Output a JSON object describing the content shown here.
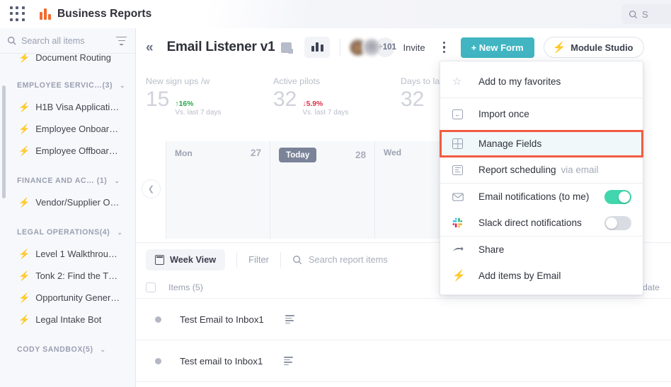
{
  "topbar": {
    "apps_icon": "apps-grid-icon",
    "logo_icon": "bar-chart-logo",
    "title": "Business Reports",
    "search_icon": "search-icon",
    "search_label": "S"
  },
  "sidebar": {
    "search": {
      "placeholder": "Search all items",
      "value": "",
      "icon": "search-icon",
      "filter_icon": "filter-icon"
    },
    "clipped_item": {
      "label": "Document Routing",
      "icon": "bolt-icon"
    },
    "groups": [
      {
        "label": "EMPLOYEE SERVIC…(3)",
        "chevron": "⌄",
        "items": [
          {
            "label": "H1B Visa Applicati…",
            "icon": "bolt-icon"
          },
          {
            "label": "Employee Onboar…",
            "icon": "bolt-icon"
          },
          {
            "label": "Employee Offboar…",
            "icon": "bolt-icon"
          }
        ]
      },
      {
        "label": "FINANCE AND AC… (1)",
        "chevron": "⌄",
        "items": [
          {
            "label": "Vendor/Supplier O…",
            "icon": "bolt-icon"
          }
        ]
      },
      {
        "label": "LEGAL OPERATIONS(4)",
        "chevron": "⌄",
        "items": [
          {
            "label": "Level 1 Walkthrou…",
            "icon": "bolt-icon"
          },
          {
            "label": "Tonk 2: Find the T…",
            "icon": "bolt-icon"
          },
          {
            "label": "Opportunity Gener…",
            "icon": "bolt-icon"
          },
          {
            "label": "Legal Intake Bot",
            "icon": "bolt-icon"
          }
        ]
      },
      {
        "label": "CODY SANDBOX(5)",
        "chevron": "⌄",
        "items": []
      }
    ]
  },
  "board_header": {
    "collapse_icon": "«",
    "title": "Email Listener v1",
    "board_type_icon": "board-icon",
    "chart_icon": "bar-chart-icon",
    "avatar_count": "+101",
    "invite_label": "Invite",
    "kebab_icon": "more-options-icon",
    "new_form_label": "+ New Form",
    "module_studio_label": "Module Studio",
    "module_studio_icon": "bolt-icon",
    "accent_teal": "#41b5c2",
    "accent_purple": "#5b4bf5"
  },
  "stats": [
    {
      "label": "New sign ups /w",
      "value": "15",
      "delta": "16%",
      "delta_arrow": "↑",
      "direction": "up",
      "sub": "Vs. last 7 days",
      "color": "#2aa84a"
    },
    {
      "label": "Active pilots",
      "value": "32",
      "delta": "5.9%",
      "delta_arrow": "↓",
      "direction": "down",
      "sub": "Vs. last 7 days",
      "color": "#d8314c"
    },
    {
      "label": "Days to launch",
      "value": "32",
      "delta": "",
      "delta_arrow": "",
      "direction": "none",
      "sub": "",
      "color": ""
    }
  ],
  "calendar": {
    "prev_icon": "chevron-left-icon",
    "columns": [
      {
        "day": "Mon",
        "num": "27",
        "is_today": false,
        "today_label": ""
      },
      {
        "day": "",
        "num": "28",
        "is_today": true,
        "today_label": "Today"
      },
      {
        "day": "Wed",
        "num": "",
        "is_today": false,
        "today_label": ""
      }
    ]
  },
  "toolbar": {
    "week_view_label": "Week View",
    "week_view_icon": "calendar-icon",
    "filter_label": "Filter",
    "search_icon": "search-icon",
    "search_placeholder": "Search report items",
    "search_value": ""
  },
  "items_table": {
    "select_all_icon": "checkbox-icon",
    "count_label": "Items (5)",
    "due_date_header": "Due date",
    "rows": [
      {
        "name": "Test Email to Inbox1",
        "status_icon": "status-dot",
        "desc_icon": "description-icon",
        "due_date": ""
      },
      {
        "name": "Test email to Inbox1",
        "status_icon": "status-dot",
        "desc_icon": "description-icon",
        "due_date": ""
      }
    ]
  },
  "menu": {
    "highlight_color": "#f15c42",
    "sections": [
      {
        "items": [
          {
            "label": "Add to my favorites",
            "sub": "",
            "icon": "star-icon",
            "type": "action",
            "highlighted": false
          }
        ]
      },
      {
        "items": [
          {
            "label": "Import once",
            "sub": "",
            "icon": "import-icon",
            "type": "action",
            "highlighted": false
          }
        ]
      },
      {
        "items": [
          {
            "label": "Manage Fields",
            "sub": "",
            "icon": "grid-icon",
            "type": "action",
            "highlighted": true
          },
          {
            "label": "Report scheduling",
            "sub": "via email",
            "icon": "report-icon",
            "type": "action",
            "highlighted": false
          }
        ]
      },
      {
        "items": [
          {
            "label": "Email notifications (to me)",
            "sub": "",
            "icon": "mail-icon",
            "type": "toggle",
            "toggle_on": true,
            "highlighted": false
          },
          {
            "label": "Slack direct notifications",
            "sub": "",
            "icon": "slack-icon",
            "type": "toggle",
            "toggle_on": false,
            "highlighted": false
          }
        ]
      },
      {
        "items": [
          {
            "label": "Share",
            "sub": "",
            "icon": "share-icon",
            "type": "action",
            "highlighted": false
          },
          {
            "label": "Add items by Email",
            "sub": "",
            "icon": "bolt-icon",
            "type": "action",
            "highlighted": false
          }
        ]
      }
    ]
  }
}
